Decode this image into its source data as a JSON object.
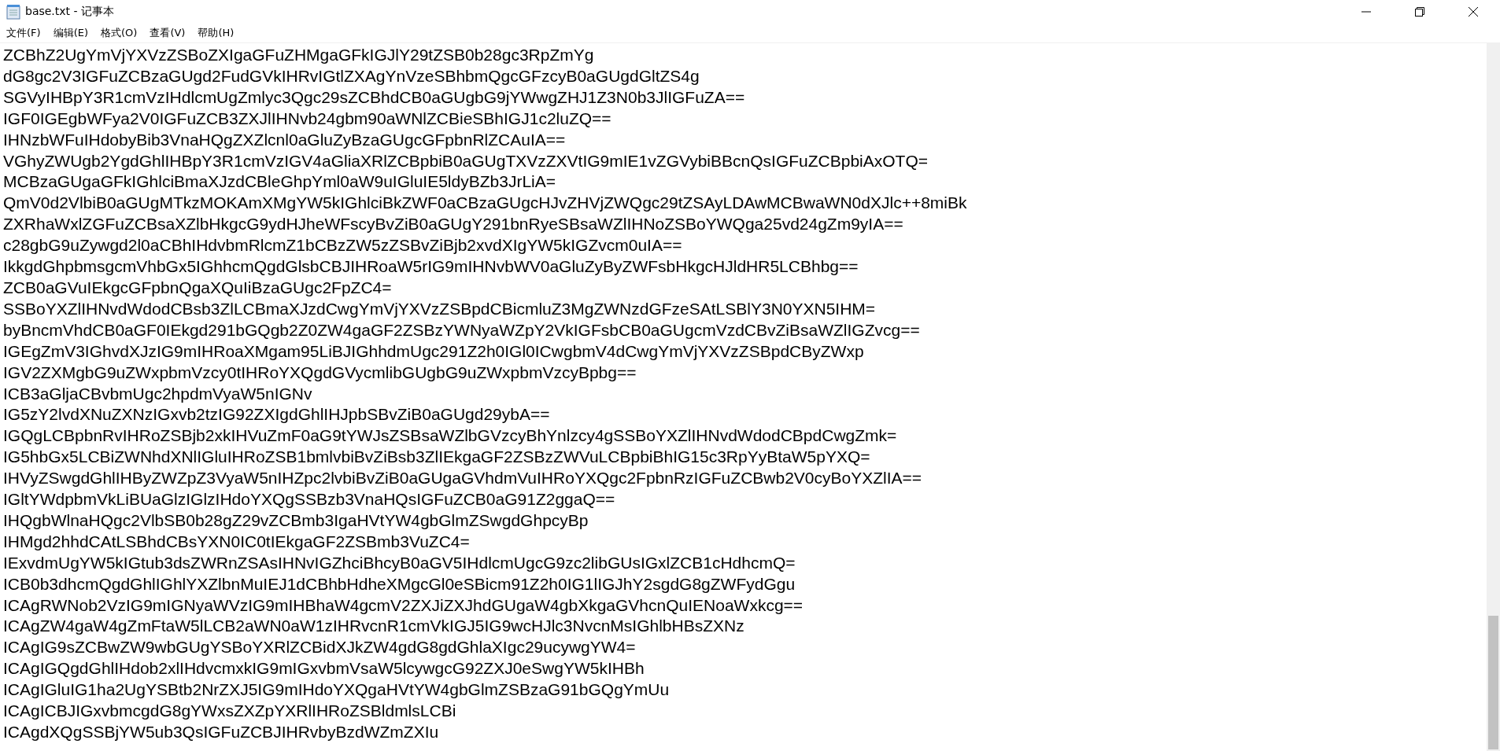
{
  "window": {
    "title": "base.txt - 记事本"
  },
  "menu": [
    "文件(F)",
    "编辑(E)",
    "格式(O)",
    "查看(V)",
    "帮助(H)"
  ],
  "lines": [
    "ZCBhZ2UgYmVjYXVzZSBoZXIgaGFuZHMgaGFkIGJlY29tZSB0b28gc3RpZmYg",
    "dG8gc2V3IGFuZCBzaGUgd2FudGVkIHRvIGtlZXAgYnVzeSBhbmQgcGFzcyB0aGUgdGltZS4g",
    "SGVyIHBpY3R1cmVzIHdlcmUgZmlyc3Qgc29sZCBhdCB0aGUgbG9jYWwgZHJ1Z3N0b3JlIGFuZA==",
    "IGF0IGEgbWFya2V0IGFuZCB3ZXJlIHNvb24gbm90aWNlZCBieSBhIGJ1c2luZQ==",
    "IHNzbWFuIHdobyBib3VnaHQgZXZlcnl0aGluZyBzaGUgcGFpbnRlZCAuIA==",
    "VGhyZWUgb2YgdGhlIHBpY3R1cmVzIGV4aGliaXRlZCBpbiB0aGUgTXVzZXVtIG9mIE1vZGVybiBBcnQsIGFuZCBpbiAxOTQ=",
    "MCBzaGUgaGFkIGhlciBmaXJzdCBleGhpYml0aW9uIGluIE5ldyBZb3JrLiA=",
    "QmV0d2VlbiB0aGUgMTkzMOKAmXMgYW5kIGhlciBkZWF0aCBzaGUgcHJvZHVjZWQgc29tZSAyLDAwMCBwaWN0dXJlc++8miBk",
    "ZXRhaWxlZGFuZCBsaXZlbHkgcG9ydHJheWFscyBvZiB0aGUgY291bnRyeSBsaWZlIHNoZSBoYWQga25vd24gZm9yIA==",
    "c28gbG9uZywgd2l0aCBhIHdvbmRlcmZ1bCBzZW5zZSBvZiBjb2xvdXIgYW5kIGZvcm0uIA==",
    "IkkgdGhpbmsgcmVhbGx5IGhhcmQgdGlsbCBJIHRoaW5rIG9mIHNvbWV0aGluZyByZWFsbHkgcHJldHR5LCBhbg==",
    "ZCB0aGVuIEkgcGFpbnQgaXQuIiBzaGUgc2FpZC4=",
    "SSBoYXZlIHNvdWdodCBsb3ZlLCBmaXJzdCwgYmVjYXVzZSBpdCBicmluZ3MgZWNzdGFzeSAtLSBlY3N0YXN5IHM=",
    "byBncmVhdCB0aGF0IEkgd291bGQgb2Z0ZW4gaGF2ZSBzYWNyaWZpY2VkIGFsbCB0aGUgcmVzdCBvZiBsaWZlIGZvcg==",
    "IGEgZmV3IGhvdXJzIG9mIHRoaXMgam95LiBJIGhhdmUgc291Z2h0IGl0ICwgbmV4dCwgYmVjYXVzZSBpdCByZWxp",
    "IGV2ZXMgbG9uZWxpbmVzcy0tIHRoYXQgdGVycmlibGUgbG9uZWxpbmVzcyBpbg==",
    "ICB3aGljaCBvbmUgc2hpdmVyaW5nIGNv",
    "IG5zY2lvdXNuZXNzIGxvb2tzIG92ZXIgdGhlIHJpbSBvZiB0aGUgd29ybA==",
    "IGQgLCBpbnRvIHRoZSBjb2xkIHVuZmF0aG9tYWJsZSBsaWZlbGVzcyBhYnlzcy4gSSBoYXZlIHNvdWdodCBpdCwgZmk=",
    "IG5hbGx5LCBiZWNhdXNlIGluIHRoZSB1bmlvbiBvZiBsb3ZlIEkgaGF2ZSBzZWVuLCBpbiBhIG15c3RpYyBtaW5pYXQ=",
    "IHVyZSwgdGhlIHByZWZpZ3VyaW5nIHZpc2lvbiBvZiB0aGUgaGVhdmVuIHRoYXQgc2FpbnRzIGFuZCBwb2V0cyBoYXZlIA==",
    "IGltYWdpbmVkLiBUaGlzIGlzIHdoYXQgSSBzb3VnaHQsIGFuZCB0aG91Z2ggaQ==",
    "IHQgbWlnaHQgc2VlbSB0b28gZ29vZCBmb3IgaHVtYW4gbGlmZSwgdGhpcyBp",
    "IHMgd2hhdCAtLSBhdCBsYXN0IC0tIEkgaGF2ZSBmb3VuZC4=",
    "IExvdmUgYW5kIGtub3dsZWRnZSAsIHNvIGZhciBhcyB0aGV5IHdlcmUgcG9zc2libGUsIGxlZCB1cHdhcmQ=",
    "ICB0b3dhcmQgdGhlIGhlYXZlbnMuIEJ1dCBhbHdheXMgcGl0eSBicm91Z2h0IG1lIGJhY2sgdG8gZWFydGgu",
    "ICAgRWNob2VzIG9mIGNyaWVzIG9mIHBhaW4gcmV2ZXJiZXJhdGUgaW4gbXkgaGVhcnQuIENoaWxkcg==",
    "ICAgZW4gaW4gZmFtaW5lLCB2aWN0aW1zIHRvcnR1cmVkIGJ5IG9wcHJlc3NvcnMsIGhlbHBsZXNz",
    "ICAgIG9sZCBwZW9wbGUgYSBoYXRlZCBidXJkZW4gdG8gdGhlaXIgc29ucywgYW4=",
    "ICAgIGQgdGhlIHdob2xlIHdvcmxkIG9mIGxvbmVsaW5lcywgcG92ZXJ0eSwgYW5kIHBh",
    "ICAgIGluIG1ha2UgYSBtb2NrZXJ5IG9mIHdoYXQgaHVtYW4gbGlmZSBzaG91bGQgYmUu",
    "ICAgICBJIGxvbmcgdG8gYWxsZXZpYXRlIHRoZSBldmlsLCBi",
    "ICAgdXQgSSBjYW5ub3QsIGFuZCBJIHRvbyBzdWZmZXIu"
  ]
}
